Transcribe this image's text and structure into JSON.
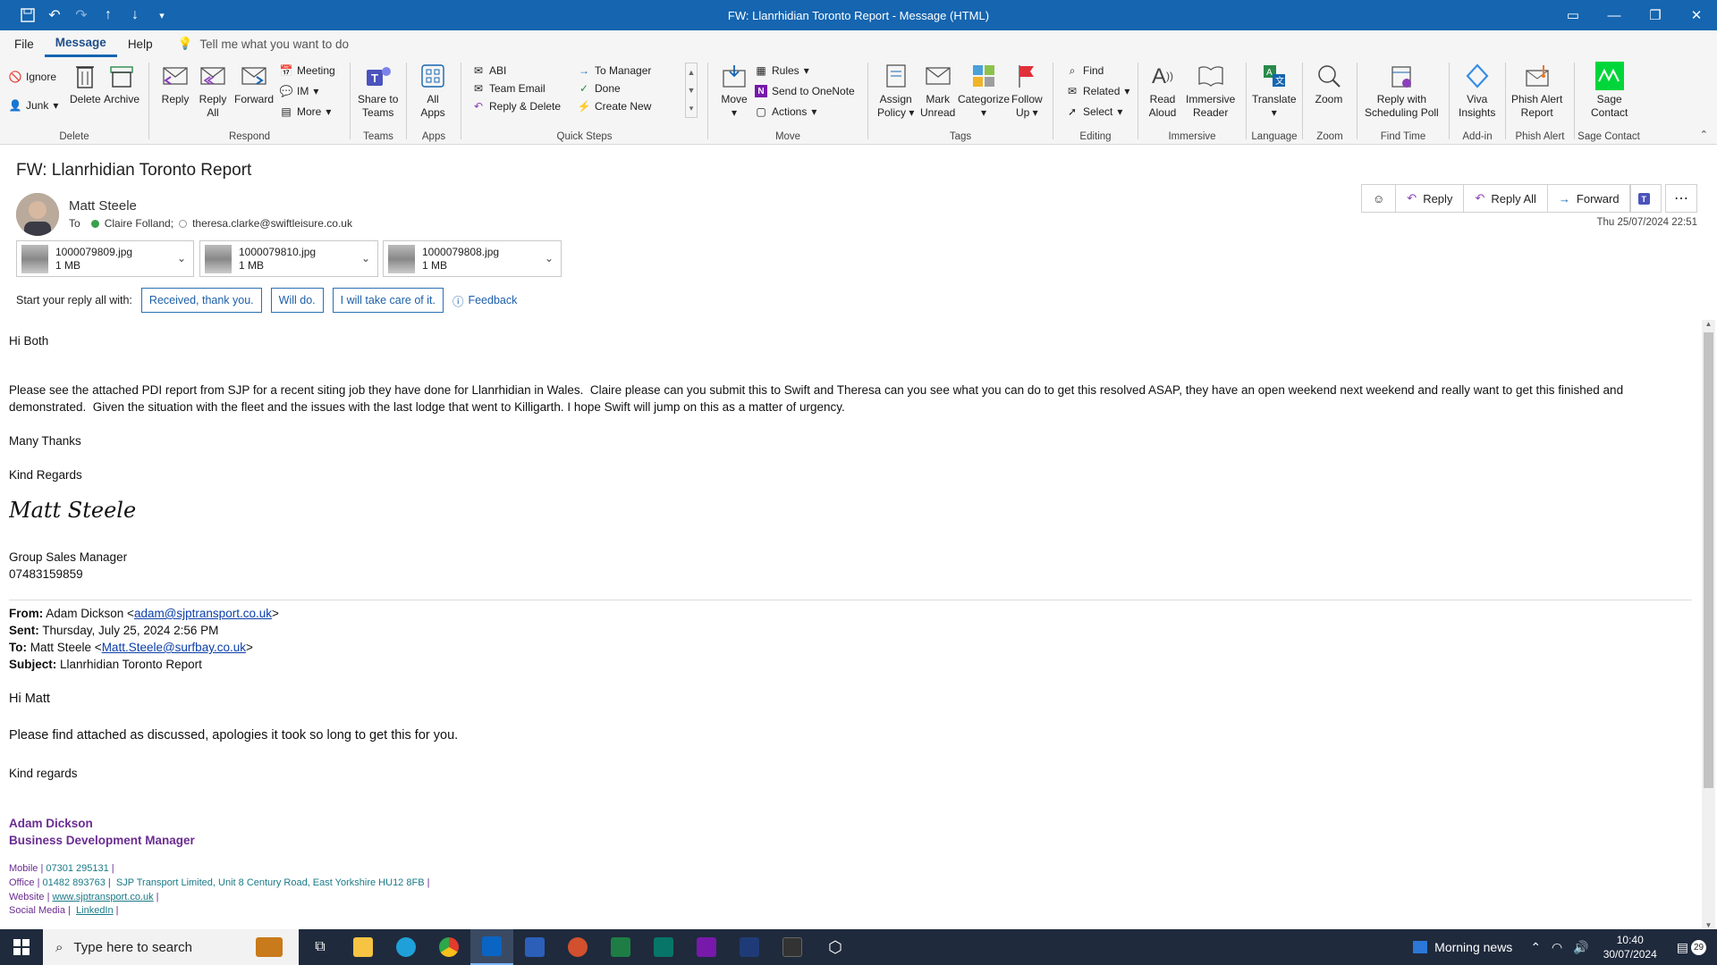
{
  "window": {
    "title": "FW: Llanrhidian Toronto Report  -  Message (HTML)"
  },
  "menu": {
    "tabs": [
      "File",
      "Message",
      "Help"
    ],
    "tellme": "Tell me what you want to do"
  },
  "ribbon": {
    "delete_group": {
      "ignore": "Ignore",
      "junk": "Junk",
      "delete": "Delete",
      "archive": "Archive",
      "label": "Delete"
    },
    "respond_group": {
      "reply": "Reply",
      "reply_all_1": "Reply",
      "reply_all_2": "All",
      "forward": "Forward",
      "meeting": "Meeting",
      "im": "IM",
      "more": "More",
      "label": "Respond"
    },
    "teams_group": {
      "share_1": "Share to",
      "share_2": "Teams",
      "label": "Teams"
    },
    "apps_group": {
      "all_1": "All",
      "all_2": "Apps",
      "label": "Apps"
    },
    "quicksteps_group": {
      "abi": "ABI",
      "team_email": "Team Email",
      "reply_delete": "Reply & Delete",
      "to_manager": "To Manager",
      "done": "Done",
      "create_new": "Create New",
      "label": "Quick Steps"
    },
    "move_group": {
      "move": "Move",
      "rules": "Rules",
      "onenote": "Send to OneNote",
      "actions": "Actions",
      "label": "Move"
    },
    "tags_group": {
      "assign_1": "Assign",
      "assign_2": "Policy",
      "mark_1": "Mark",
      "mark_2": "Unread",
      "categorize": "Categorize",
      "follow_1": "Follow",
      "follow_2": "Up",
      "label": "Tags"
    },
    "editing_group": {
      "find": "Find",
      "related": "Related",
      "select": "Select",
      "label": "Editing"
    },
    "immersive_group": {
      "read_1": "Read",
      "read_2": "Aloud",
      "reader_1": "Immersive",
      "reader_2": "Reader",
      "label": "Immersive"
    },
    "language_group": {
      "translate": "Translate",
      "label": "Language"
    },
    "zoom_group": {
      "zoom": "Zoom",
      "label": "Zoom"
    },
    "findtime_group": {
      "poll_1": "Reply with",
      "poll_2": "Scheduling Poll",
      "label": "Find Time"
    },
    "addin_group": {
      "viva_1": "Viva",
      "viva_2": "Insights",
      "label": "Add-in"
    },
    "phish_group": {
      "phish_1": "Phish Alert",
      "phish_2": "Report",
      "label": "Phish Alert"
    },
    "sage_group": {
      "sage_1": "Sage",
      "sage_2": "Contact",
      "label": "Sage Contact"
    }
  },
  "message": {
    "subject": "FW: Llanrhidian Toronto Report",
    "sender": "Matt Steele",
    "to_label": "To",
    "recipient_1": "Claire Folland;",
    "recipient_2": "theresa.clarke@swiftleisure.co.uk",
    "date": "Thu 25/07/2024 22:51",
    "actions": {
      "reply": "Reply",
      "reply_all": "Reply All",
      "forward": "Forward"
    },
    "attachments": [
      {
        "name": "1000079809.jpg",
        "size": "1 MB"
      },
      {
        "name": "1000079810.jpg",
        "size": "1 MB"
      },
      {
        "name": "1000079808.jpg",
        "size": "1 MB"
      }
    ],
    "quick_reply": {
      "prompt": "Start your reply all with:",
      "options": [
        "Received, thank you.",
        "Will do.",
        "I will take care of it."
      ],
      "feedback": "Feedback"
    }
  },
  "body": {
    "greeting": "Hi Both",
    "para1": "Please see the attached PDI report from SJP for a recent siting job they have done for Llanrhidian in Wales.  Claire please can you submit this to Swift and Theresa can you see what you can do to get this resolved ASAP, they have an open weekend next weekend and really want to get this finished and demonstrated.  Given the situation with the fleet and the issues with the last lodge that went to Killigarth. I hope Swift will jump on this as a matter of urgency.",
    "thanks": "Many Thanks",
    "regards": "Kind Regards",
    "signature": "Matt Steele",
    "role": "Group Sales Manager",
    "phone": "07483159859",
    "fwd": {
      "from_label": "From:",
      "from_name": "Adam Dickson <",
      "from_email": "adam@sjptransport.co.uk",
      "sent_label": "Sent:",
      "sent": "Thursday, July 25, 2024 2:56 PM",
      "to_label": "To:",
      "to_name": "Matt Steele <",
      "to_email": "Matt.Steele@surfbay.co.uk",
      "subject_label": "Subject:",
      "subject": "Llanrhidian Toronto Report"
    },
    "fwd_greeting": "Hi Matt",
    "fwd_para": "Please find attached as discussed, apologies it took so long to get this for you.",
    "fwd_regards": "Kind regards",
    "sig_name": "Adam Dickson",
    "sig_title": "Business Development Manager",
    "mobile_label": "Mobile |",
    "mobile": "07301 295131",
    "office_label": "Office |",
    "office": "01482 893763",
    "office_addr": "SJP Transport Limited, Unit 8 Century Road, East Yorkshire HU12 8FB",
    "website_label": "Website |",
    "website": "www.sjptransport.co.uk",
    "social_label": "Social Media |",
    "social": "LinkedIn"
  },
  "taskbar": {
    "search": "Type here to search",
    "news": "Morning news",
    "time": "10:40",
    "date": "30/07/2024",
    "notifications": "29"
  }
}
